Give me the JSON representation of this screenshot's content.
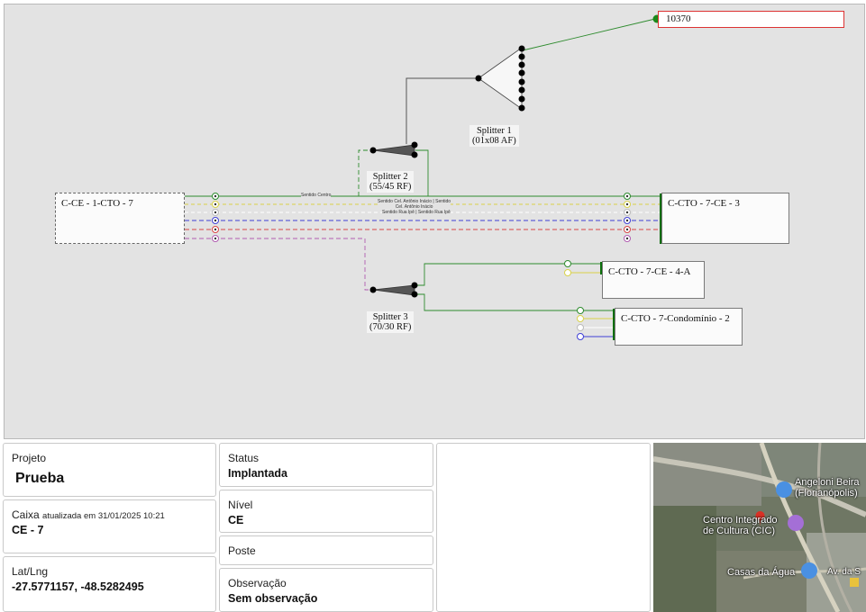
{
  "diagram": {
    "boxes": {
      "source": "C-CE - 1-CTO - 7",
      "cto_ce3": "C-CTO - 7-CE - 3",
      "cto_ce4a": "C-CTO - 7-CE - 4-A",
      "cto_cond2": "C-CTO - 7-Condomínio - 2"
    },
    "reference": "10370",
    "splitters": [
      {
        "name": "Splitter 1",
        "ratio": "(01x08 AF)"
      },
      {
        "name": "Splitter 2",
        "ratio": "(55/45 RF)"
      },
      {
        "name": "Splitter 3",
        "ratio": "(70/30 RF)"
      }
    ],
    "fiber_tags": {
      "centro": "Sentido Centro",
      "cel_line1": "Sentido Cel. Antônio Inácio | Sentido",
      "cel_line2": "Cel. Antônio Inácio",
      "ipe": "Sentido Rua Ipê | Sentido Rua Ipê"
    },
    "colors": {
      "green": "#2e8b2e",
      "yellow": "#d9d24a",
      "white": "#ffffff",
      "blue": "#3f3fd6",
      "red": "#d84545",
      "violet": "#b05cb0",
      "connector": "#0a6d0a"
    }
  },
  "info": {
    "projeto_label": "Projeto",
    "projeto_value": "Prueba",
    "caixa_label": "Caixa",
    "caixa_updated": "atualizada em 31/01/2025 10:21",
    "caixa_value": "CE - 7",
    "latlng_label": "Lat/Lng",
    "latlng_value": "-27.5771157, -48.5282495",
    "status_label": "Status",
    "status_value": "Implantada",
    "nivel_label": "Nível",
    "nivel_value": "CE",
    "poste_label": "Poste",
    "obs_label": "Observação",
    "obs_value": "Sem observação"
  },
  "map": {
    "labels": {
      "angeloni_1": "Angeloni Beira",
      "angeloni_2": "(Florianópolis)",
      "cic_1": "Centro Integrado",
      "cic_2": "de Cultura (CIC)",
      "casas": "Casas da Água",
      "road": "Av. da S"
    }
  }
}
